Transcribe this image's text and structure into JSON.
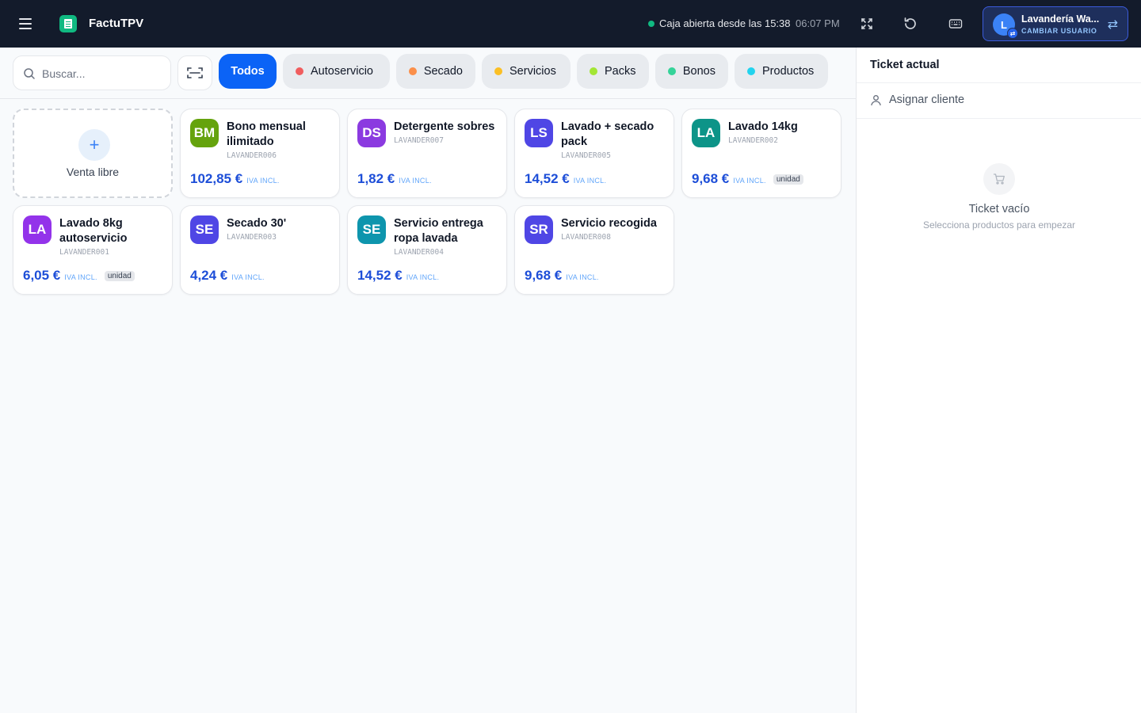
{
  "header": {
    "app_title": "FactuTPV",
    "caja_status": "Caja abierta desde las 15:38",
    "clock": "06:07 PM",
    "user": {
      "initial": "L",
      "name": "Lavandería Wa...",
      "action": "CAMBIAR USUARIO"
    }
  },
  "search": {
    "placeholder": "Buscar..."
  },
  "categories": [
    {
      "label": "Todos",
      "color": null,
      "active": true
    },
    {
      "label": "Autoservicio",
      "color": "#f05d5e"
    },
    {
      "label": "Secado",
      "color": "#fb8f4a"
    },
    {
      "label": "Servicios",
      "color": "#fbbf24"
    },
    {
      "label": "Packs",
      "color": "#a3e635"
    },
    {
      "label": "Bonos",
      "color": "#34d399"
    },
    {
      "label": "Productos",
      "color": "#22d3ee"
    }
  ],
  "free_sale": {
    "label": "Venta libre"
  },
  "tax_label": "IVA INCL.",
  "products": [
    {
      "initials": "BM",
      "name": "Bono mensual ilimitado",
      "sku": "LAVANDER006",
      "price": "102,85 €",
      "unit": "",
      "color": "#65a30d"
    },
    {
      "initials": "DS",
      "name": "Detergente sobres",
      "sku": "LAVANDER007",
      "price": "1,82 €",
      "unit": "",
      "color": "#8b3ae0"
    },
    {
      "initials": "LS",
      "name": "Lavado + secado pack",
      "sku": "LAVANDER005",
      "price": "14,52 €",
      "unit": "",
      "color": "#4f46e5"
    },
    {
      "initials": "LA",
      "name": "Lavado 14kg",
      "sku": "LAVANDER002",
      "price": "9,68 €",
      "unit": "unidad",
      "color": "#0d9488"
    },
    {
      "initials": "LA",
      "name": "Lavado 8kg autoservicio",
      "sku": "LAVANDER001",
      "price": "6,05 €",
      "unit": "unidad",
      "color": "#9333ea"
    },
    {
      "initials": "SE",
      "name": "Secado 30'",
      "sku": "LAVANDER003",
      "price": "4,24 €",
      "unit": "",
      "color": "#4f46e5"
    },
    {
      "initials": "SE",
      "name": "Servicio entrega ropa lavada",
      "sku": "LAVANDER004",
      "price": "14,52 €",
      "unit": "",
      "color": "#0e95ad"
    },
    {
      "initials": "SR",
      "name": "Servicio recogida",
      "sku": "LAVANDER008",
      "price": "9,68 €",
      "unit": "",
      "color": "#4f46e5"
    }
  ],
  "ticket": {
    "title": "Ticket actual",
    "assign_client": "Asignar cliente",
    "empty_title": "Ticket vacío",
    "empty_subtitle": "Selecciona productos para empezar"
  },
  "icons": {
    "menu": "hamburger-icon",
    "fullscreen": "fullscreen-icon",
    "refresh": "refresh-icon",
    "keyboard": "keyboard-icon",
    "swap": "swap-icon",
    "search": "search-icon",
    "scan": "barcode-scan-icon",
    "user": "user-icon",
    "cart": "cart-icon"
  }
}
